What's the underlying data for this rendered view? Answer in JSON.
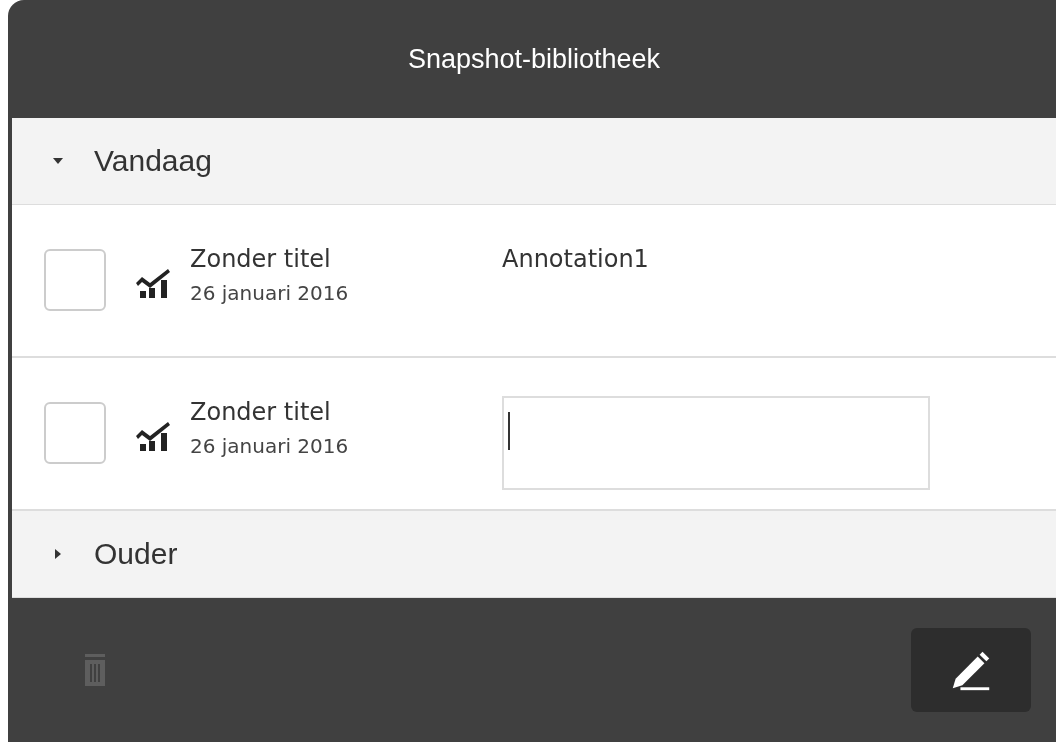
{
  "window": {
    "title": "Snapshot-bibliotheek"
  },
  "groups": [
    {
      "label": "Vandaag",
      "expanded": true,
      "items": [
        {
          "title": "Zonder titel",
          "date": "26 januari 2016",
          "checked": false,
          "kind": "text",
          "annotation": "Annotation1"
        },
        {
          "title": "Zonder titel",
          "date": "26 januari 2016",
          "checked": false,
          "kind": "input"
        }
      ]
    },
    {
      "label": "Ouder",
      "expanded": false
    }
  ],
  "toolbar": {
    "delete_disabled": true
  }
}
